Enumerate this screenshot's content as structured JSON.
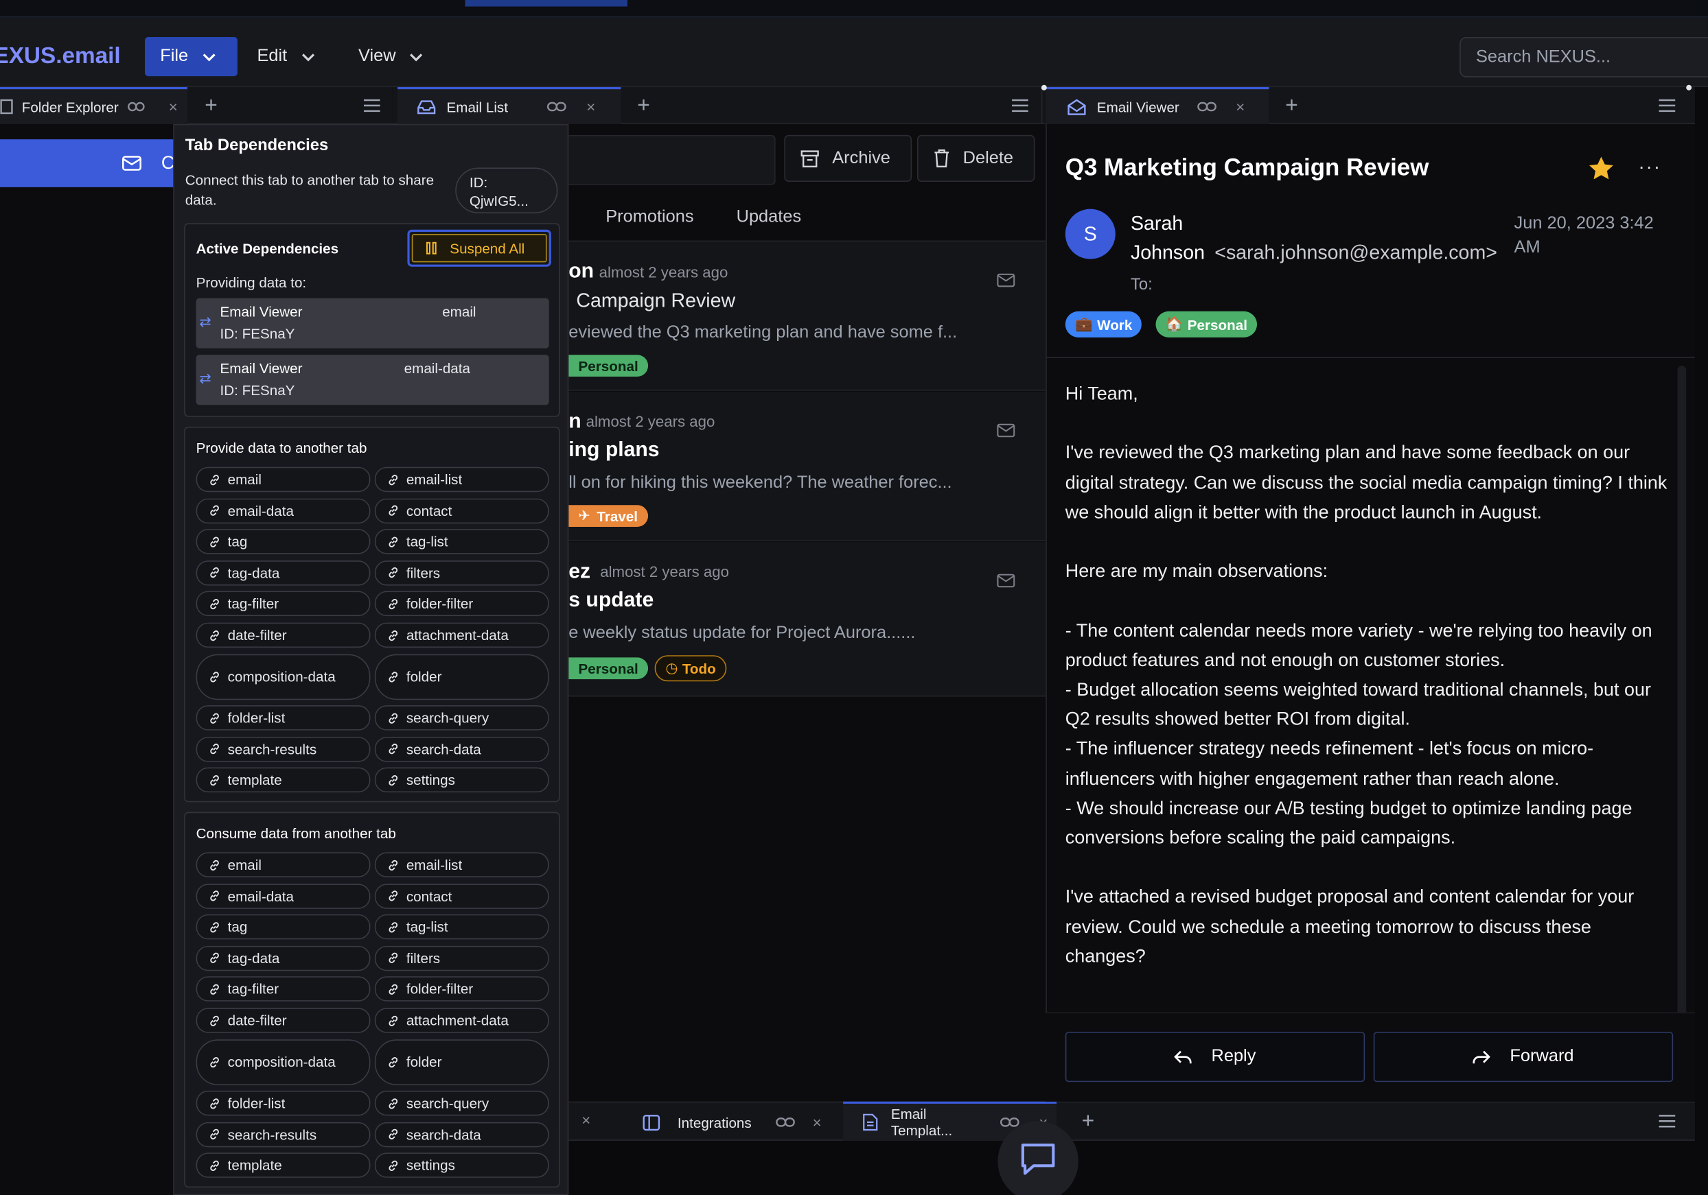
{
  "app": {
    "logo": "EXUS.email"
  },
  "menu": {
    "file": "File",
    "edit": "Edit",
    "view": "View"
  },
  "search": {
    "placeholder": "Search NEXUS..."
  },
  "tabs": {
    "folder_explorer": "Folder Explorer",
    "email_list": "Email List",
    "email_viewer": "Email Viewer",
    "integrations": "Integrations",
    "email_templates": "Email Templat..."
  },
  "compose": {
    "label": "C"
  },
  "email_list": {
    "archive": "Archive",
    "delete": "Delete",
    "categories": [
      "Promotions",
      "Updates"
    ],
    "items": [
      {
        "sender": "on",
        "time": "almost 2 years ago",
        "subject": "Campaign Review",
        "preview": "eviewed the Q3 marketing plan and have some f...",
        "tags": [
          "Personal"
        ]
      },
      {
        "sender": "n",
        "time": "almost 2 years ago",
        "subject": "ing plans",
        "preview": "ll on for hiking this weekend? The weather forec...",
        "tags": [
          "Travel"
        ]
      },
      {
        "sender": "ez",
        "time": "almost 2 years ago",
        "subject": "s update",
        "preview": "e weekly status update for Project Aurora......",
        "tags": [
          "Personal",
          "Todo"
        ]
      }
    ]
  },
  "dependencies": {
    "title": "Tab Dependencies",
    "description": "Connect this tab to another tab to share data.",
    "id_label": "ID:",
    "id_value": "QjwIG5...",
    "active_title": "Active Dependencies",
    "suspend_all": "Suspend All",
    "providing_label": "Providing data to:",
    "providing": [
      {
        "name": "Email Viewer",
        "id": "ID: FESnaY",
        "type": "email"
      },
      {
        "name": "Email Viewer",
        "id": "ID: FESnaY",
        "type": "email-data"
      }
    ],
    "provide_title": "Provide data to another tab",
    "consume_title": "Consume data from another tab",
    "types": [
      "email",
      "email-list",
      "email-data",
      "contact",
      "tag",
      "tag-list",
      "tag-data",
      "filters",
      "tag-filter",
      "folder-filter",
      "date-filter",
      "attachment-data",
      "composition-data",
      "folder",
      "folder-list",
      "search-query",
      "search-results",
      "search-data",
      "template",
      "settings"
    ]
  },
  "viewer": {
    "subject": "Q3 Marketing Campaign Review",
    "avatar_letter": "S",
    "sender_first": "Sarah",
    "sender_last": "Johnson",
    "sender_email": "<sarah.johnson@example.com>",
    "date_line1": "Jun 20, 2023 3:42",
    "date_line2": "AM",
    "to_label": "To:",
    "tags": [
      {
        "label": "Work",
        "emoji": "💼",
        "color": "#3b82f6"
      },
      {
        "label": "Personal",
        "emoji": "🏠",
        "color": "#4caf6a"
      }
    ],
    "body": [
      "Hi Team,",
      "",
      "I've reviewed the Q3 marketing plan and have some feedback on our digital strategy. Can we discuss the social media campaign timing? I think we should align it better with the product launch in August.",
      "",
      "Here are my main observations:",
      "",
      "- The content calendar needs more variety - we're relying too heavily on product features and not enough on customer stories.",
      "- Budget allocation seems weighted toward traditional channels, but our Q2 results showed better ROI from digital.",
      "- The influencer strategy needs refinement - let's focus on micro-influencers with higher engagement rather than reach alone.",
      "- We should increase our A/B testing budget to optimize landing page conversions before scaling the paid campaigns.",
      "",
      "I've attached a revised budget proposal and content calendar for your review. Could we schedule a meeting tomorrow to discuss these changes?"
    ],
    "reply": "Reply",
    "forward": "Forward"
  },
  "colors": {
    "accent": "#3b5bdb",
    "personal": "#4caf6a",
    "travel": "#e8863a",
    "todo": "#f5a524",
    "star": "#f5b82e"
  }
}
